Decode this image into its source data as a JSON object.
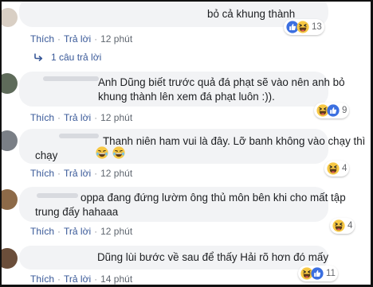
{
  "comments": [
    {
      "text": "bỏ cả khung thành",
      "actions": {
        "like": "Thích",
        "reply": "Trả lời",
        "time": "12 phút"
      },
      "reaction_count": "13",
      "reactions": [
        "like-icon",
        "haha-icon"
      ]
    },
    {
      "text_lines": [
        "Anh Dũng biết trước quả đá phạt sẽ vào nên anh bỏ",
        "khung thành lên xem đá phạt luôn :))."
      ],
      "actions": {
        "like": "Thích",
        "reply": "Trả lời",
        "time": "12 phút"
      },
      "reaction_count": "9",
      "reactions": [
        "haha-icon",
        "like-icon"
      ]
    },
    {
      "text_lines": [
        "Thanh niên ham vui là đây. Lỡ banh không vào chạy thì",
        "chạy"
      ],
      "emoji": [
        "laughing-emoji",
        "laughing-emoji"
      ],
      "actions": {
        "like": "Thích",
        "reply": "Trả lời",
        "time": "12 phút"
      },
      "reaction_count": "4",
      "reactions": [
        "haha-icon"
      ]
    },
    {
      "text_lines": [
        "oppa đang đứng lườm ông thủ môn bên khi cho mất tập",
        "trung đấy hahaaa"
      ],
      "actions": {
        "like": "Thích",
        "reply": "Trả lời",
        "time": "12 phút"
      },
      "reaction_count": "4",
      "reactions": [
        "haha-icon"
      ]
    },
    {
      "text": "Dũng lùi bước về sau để thấy Hải rõ hơn đó mấy",
      "actions": {
        "like": "Thích",
        "reply": "Trả lời",
        "time": "14 phút"
      },
      "reaction_count": "11",
      "reactions": [
        "haha-icon",
        "like-icon"
      ]
    }
  ],
  "reply_link": "1 câu trả lời",
  "colors": {
    "link": "#385898",
    "bubble": "#f2f3f5",
    "meta": "#606770",
    "like_blue": "#3b6fe0",
    "haha_yellow": "#f7c844"
  }
}
